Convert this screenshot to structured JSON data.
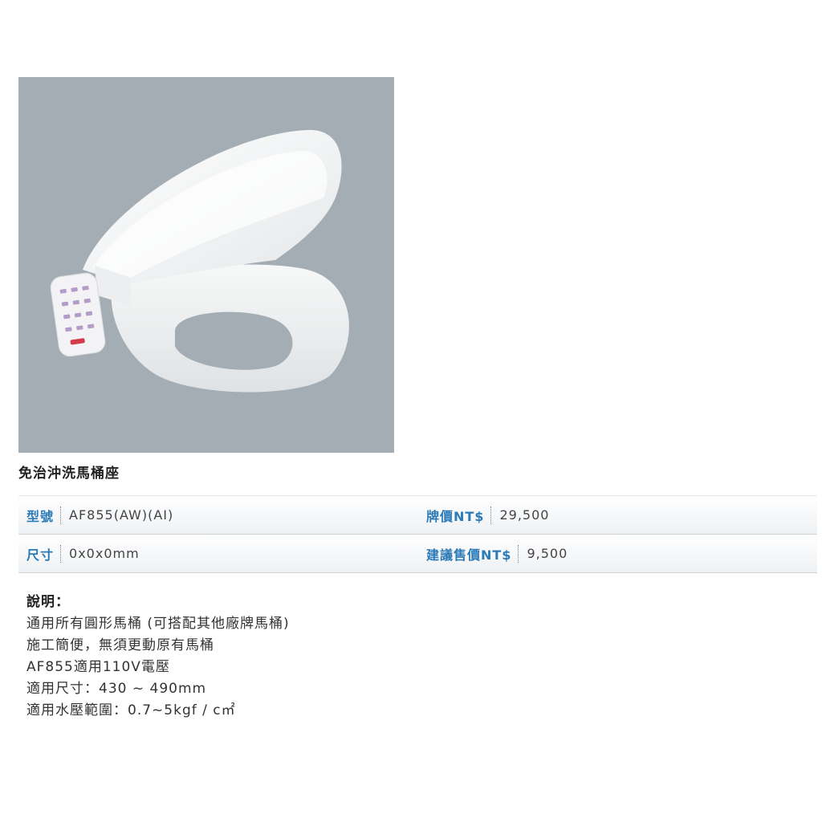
{
  "product": {
    "image_alt": "toilet-seat-photo",
    "name": "免治沖洗馬桶座"
  },
  "specs": {
    "model_label": "型號",
    "model_value": "AF855(AW)(AI)",
    "list_price_label": "牌價NT$",
    "list_price_value": "29,500",
    "size_label": "尺寸",
    "size_value": "0x0x0mm",
    "suggested_price_label": "建議售價NT$",
    "suggested_price_value": "9,500"
  },
  "description": {
    "heading": "說明：",
    "lines": [
      "通用所有圓形馬桶 (可搭配其他廠牌馬桶)",
      "施工簡便，無須更動原有馬桶",
      "AF855適用110V電壓",
      "適用尺寸：430 ~ 490mm",
      "適用水壓範圍：0.7~5kgf / c㎡"
    ]
  },
  "colors": {
    "photo_background": "#a3adb3",
    "label_blue": "#2a7ab8"
  }
}
